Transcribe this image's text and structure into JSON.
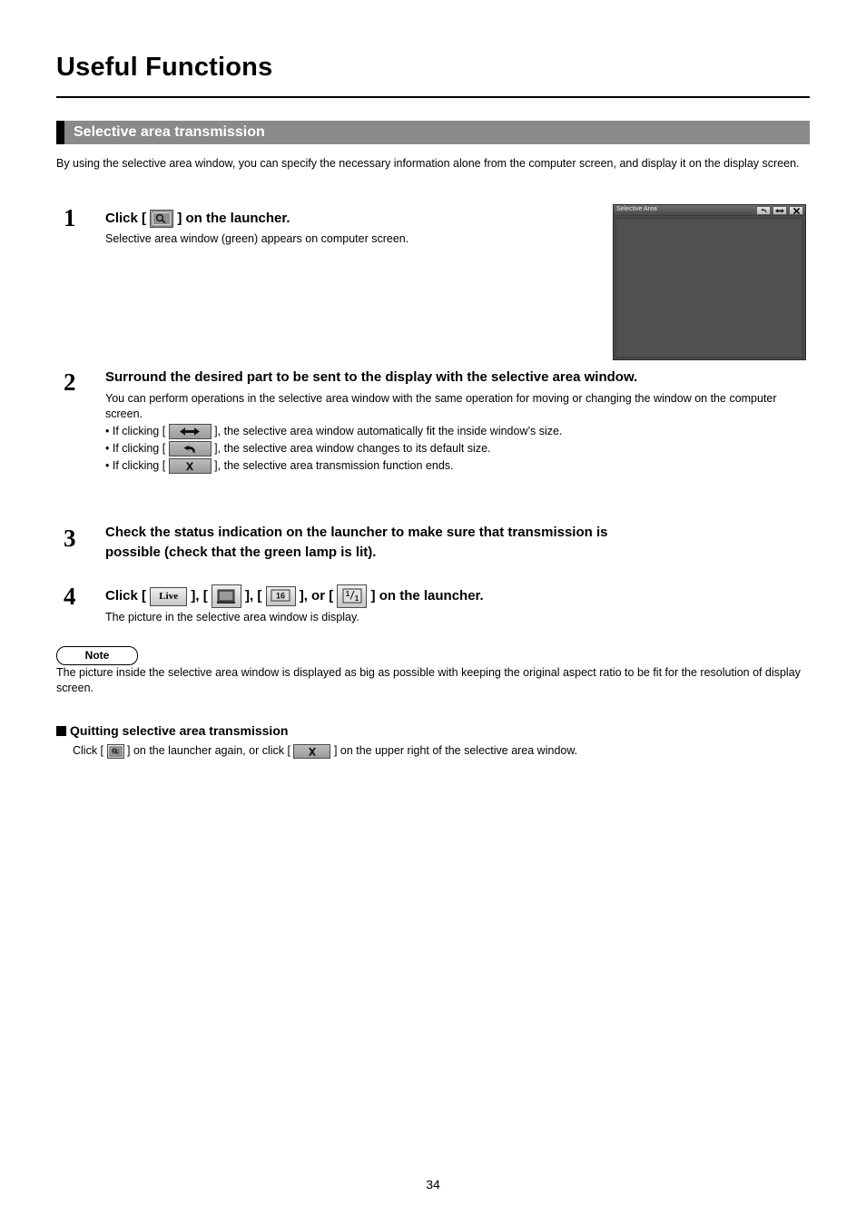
{
  "header": {
    "title": "Useful Functions",
    "section_title": "Selective area transmission"
  },
  "intro": "By using the selective area window, you can specify the necessary information alone from the computer screen, and display it on the display screen.",
  "steps": [
    {
      "number": "1",
      "heading_before": "Click [",
      "heading_after": "] on the launcher.",
      "body": "Selective area window (green) appears on computer screen."
    },
    {
      "number": "2",
      "heading": "Surround the desired part to be sent to the display with the selective area window.",
      "body": "You can perform operations in the selective area window with the same operation for moving or changing the window on the computer screen.",
      "bullets": [
        {
          "before": "• If clicking [",
          "after": "], the selective area window automatically fit the inside window’s size."
        },
        {
          "before": "• If clicking [",
          "after": "], the selective area window changes to its default size."
        },
        {
          "before": "• If clicking [",
          "after": "], the selective area transmission function ends."
        }
      ]
    },
    {
      "number": "3",
      "heading_line1": "Check the status indication on the launcher to make sure that transmission is",
      "heading_line2": "possible (check that the green lamp is lit)."
    },
    {
      "number": "4",
      "heading_parts": {
        "p0": "Click [",
        "p1": "], [",
        "p2": "], [",
        "p3": "], or [",
        "p4": "] on the launcher."
      },
      "live_label": "Live",
      "sixteen_label": "16",
      "one_label": "1",
      "body": "The picture in the selective area window is display."
    }
  ],
  "note": {
    "label": "Note",
    "text": "The picture inside the selective area window is displayed as big as possible with keeping the original aspect ratio to be fit for the resolution of display screen."
  },
  "quitting": {
    "heading": "Quitting selective area transmission",
    "text_before": "Click [",
    "text_middle": "] on the launcher again, or click [",
    "text_after": "] on the upper right of the selective area window."
  },
  "selective_area_window": {
    "title": "Selective Area",
    "buttons": [
      "default-size-icon",
      "fit-size-icon",
      "close-icon"
    ]
  },
  "page_number": "34",
  "colors": {
    "section_bar": "#8a8a8a",
    "section_accent": "#000000",
    "window_body": "#4b4b4b",
    "window_inner": "#505050"
  }
}
